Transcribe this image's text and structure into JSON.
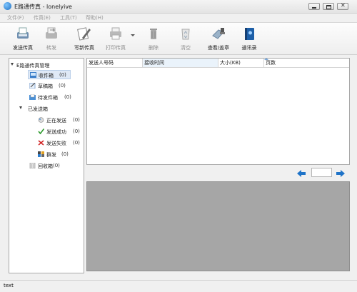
{
  "window": {
    "title": "E路通传真 - lonelyive"
  },
  "menu": [
    "文件(F)",
    "传真(E)",
    "工具(T)",
    "帮助(H)"
  ],
  "toolbar": {
    "send_fax": "发送传真",
    "forward": "转发",
    "write_fax": "写新传真",
    "print_fax": "打印传真",
    "delete": "删除",
    "clear": "清空",
    "view_stamp": "查看/盖章",
    "contacts": "通讯录"
  },
  "tree": {
    "root": "E路通传真管理",
    "inbox": {
      "label": "收件箱",
      "count": "(0)"
    },
    "drafts": {
      "label": "草稿箱",
      "count": "(0)"
    },
    "outbox_pending": {
      "label": "待发件箱",
      "count": "(0)"
    },
    "sent": {
      "label": "已发送箱"
    },
    "sending": {
      "label": "正在发送",
      "count": "(0)"
    },
    "sent_ok": {
      "label": "发送成功",
      "count": "(0)"
    },
    "sent_fail": {
      "label": "发送失败",
      "count": "(0)"
    },
    "group": {
      "label": "群发",
      "count": "(0)"
    },
    "recycle": {
      "label": "回收箱",
      "count": "(0)"
    }
  },
  "list": {
    "columns": [
      "发送人号码",
      "接收时间",
      "大小(KB)",
      "页数"
    ]
  },
  "pagination": {
    "page": ""
  },
  "status": {
    "text": "text"
  },
  "colors": {
    "selection": "#dfe9f6",
    "preview_bg": "#a6a6a6",
    "nav_arrow": "#1e73c8"
  }
}
